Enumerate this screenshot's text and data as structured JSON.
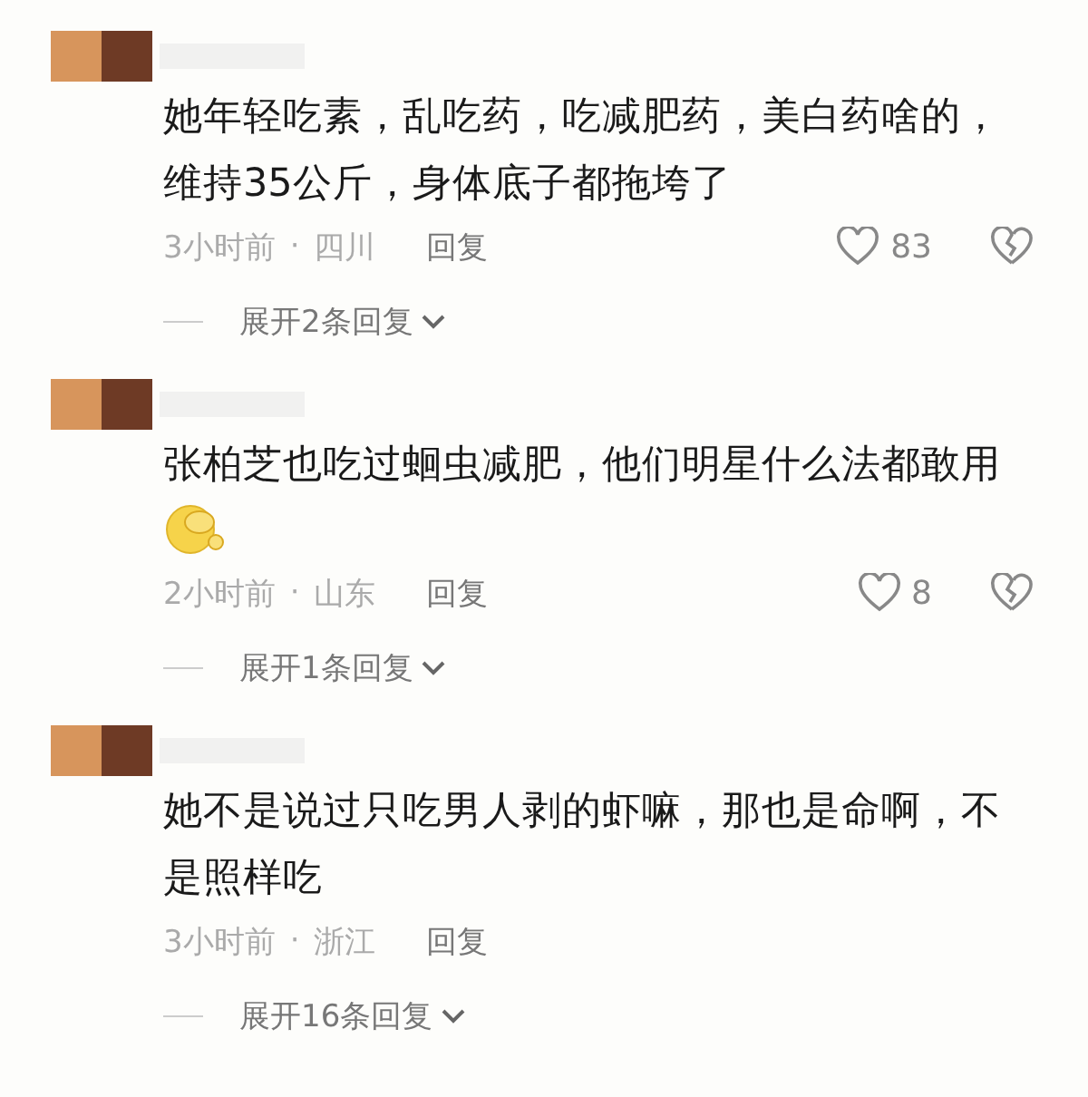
{
  "comments": [
    {
      "text": "她年轻吃素，乱吃药，吃减肥药，美白药啥的，维持35公斤，身体底子都拖垮了",
      "emoji": false,
      "time": "3小时前",
      "separator": "·",
      "location": "四川",
      "reply": "回复",
      "likes": "83",
      "expand": "展开2条回复"
    },
    {
      "text": "张柏芝也吃过蛔虫减肥，他们明星什么法都敢用",
      "emoji": true,
      "time": "2小时前",
      "separator": "·",
      "location": "山东",
      "reply": "回复",
      "likes": "8",
      "expand": "展开1条回复"
    },
    {
      "text": "她不是说过只吃男人剥的虾嘛，那也是命啊，不是照样吃",
      "emoji": false,
      "time": "3小时前",
      "separator": "·",
      "location": "浙江",
      "reply": "回复",
      "expand": "展开16条回复"
    }
  ]
}
